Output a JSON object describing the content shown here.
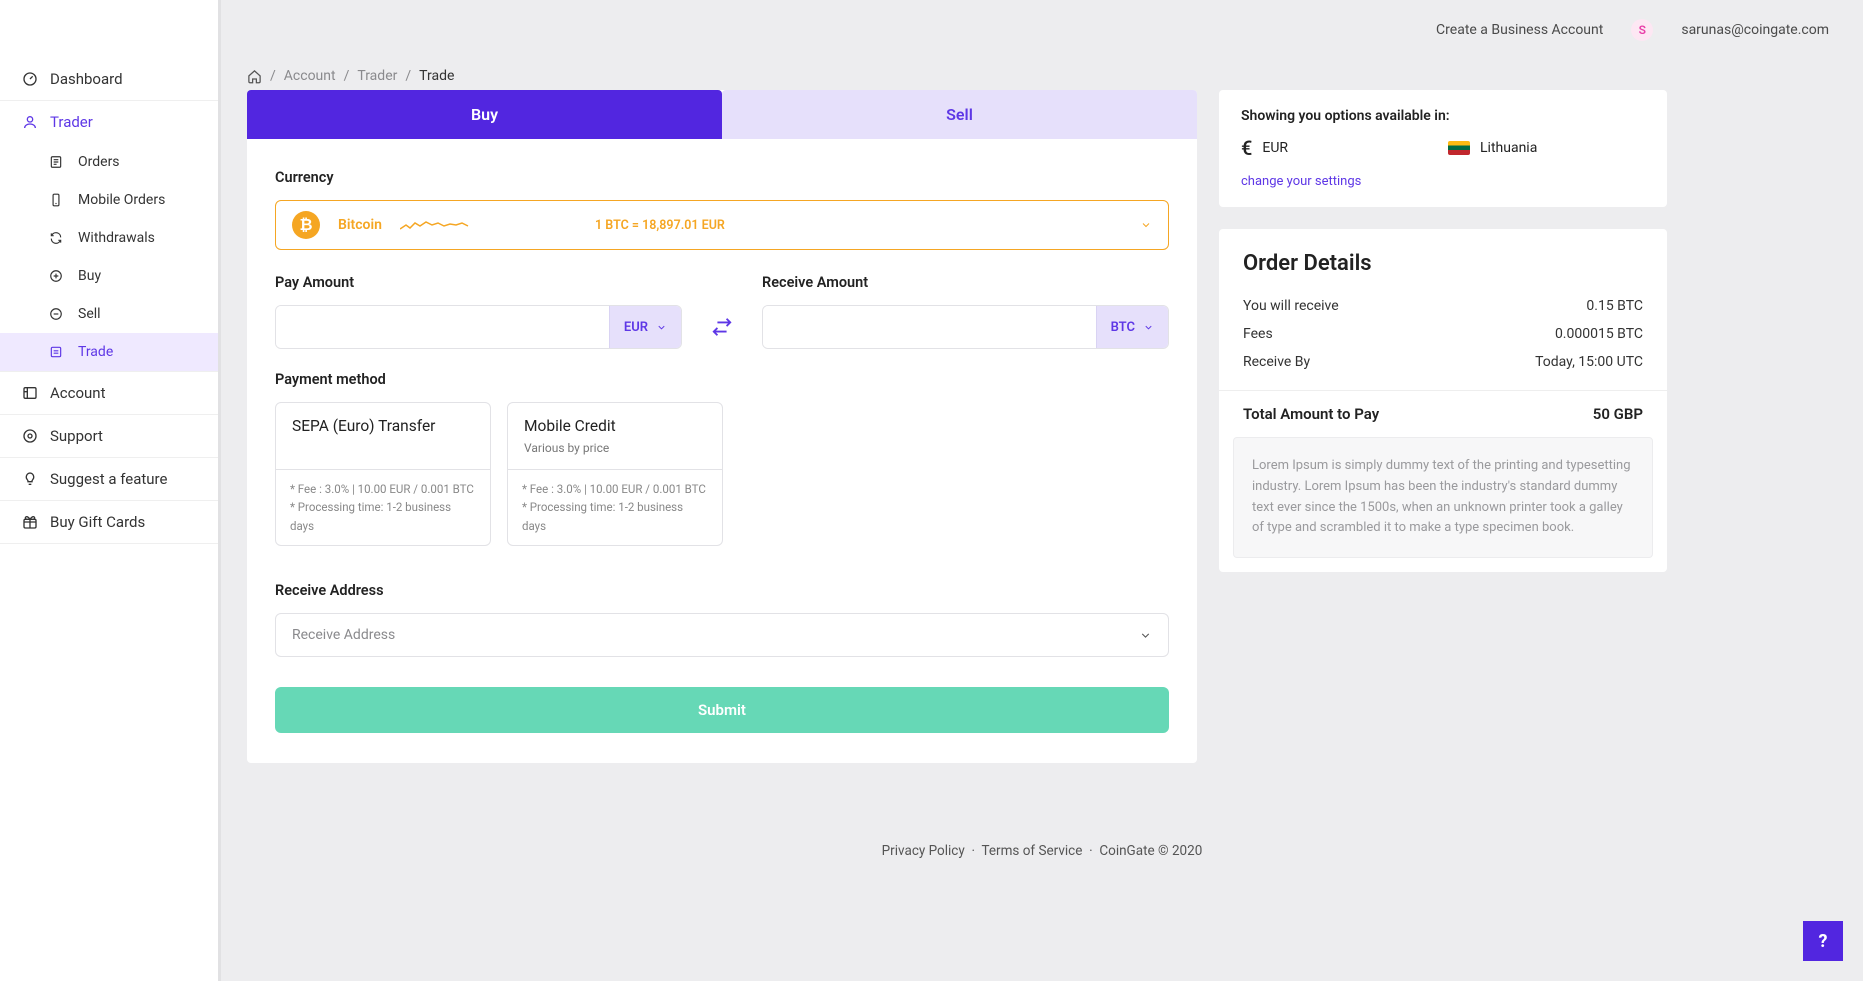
{
  "header": {
    "business_link": "Create a Business Account",
    "avatar_initial": "S",
    "user_email": "sarunas@coingate.com"
  },
  "sidebar": {
    "items": [
      {
        "label": "Dashboard"
      },
      {
        "label": "Trader"
      }
    ],
    "trader_sub": [
      {
        "label": "Orders"
      },
      {
        "label": "Mobile Orders"
      },
      {
        "label": "Withdrawals"
      },
      {
        "label": "Buy"
      },
      {
        "label": "Sell"
      },
      {
        "label": "Trade"
      }
    ],
    "bottom": [
      {
        "label": "Account"
      },
      {
        "label": "Support"
      },
      {
        "label": "Suggest a feature"
      },
      {
        "label": "Buy Gift Cards"
      }
    ]
  },
  "breadcrumb": {
    "a": "Account",
    "b": "Trader",
    "c": "Trade"
  },
  "tabs": {
    "buy": "Buy",
    "sell": "Sell"
  },
  "form": {
    "currency_label": "Currency",
    "currency_name": "Bitcoin",
    "currency_rate": "1 BTC = 18,897.01 EUR",
    "pay_label": "Pay Amount",
    "pay_unit": "EUR",
    "recv_label": "Receive Amount",
    "recv_unit": "BTC",
    "pm_label": "Payment method",
    "pm": [
      {
        "title": "SEPA (Euro) Transfer",
        "sub": "",
        "fee": "* Fee : 3.0% | 10.00 EUR / 0.001 BTC",
        "proc": "* Processing time: 1-2 business days"
      },
      {
        "title": "Mobile Credit",
        "sub": "Various by price",
        "fee": "* Fee : 3.0% | 10.00 EUR / 0.001 BTC",
        "proc": "* Processing time: 1-2 business days"
      }
    ],
    "addr_label": "Receive Address",
    "addr_placeholder": "Receive Address",
    "submit": "Submit"
  },
  "options": {
    "title": "Showing you options available in:",
    "currency": "EUR",
    "country": "Lithuania",
    "change": "change your settings"
  },
  "order": {
    "title": "Order Details",
    "rows": [
      {
        "k": "You will receive",
        "v": "0.15 BTC"
      },
      {
        "k": "Fees",
        "v": "0.000015 BTC"
      },
      {
        "k": "Receive By",
        "v": "Today, 15:00 UTC"
      }
    ],
    "total_k": "Total Amount to Pay",
    "total_v": "50 GBP",
    "note": "Lorem Ipsum is simply dummy text of the printing and typesetting industry. Lorem Ipsum has been the industry's standard dummy text ever since the 1500s, when an unknown printer took a galley of type and scrambled it to make a type specimen book."
  },
  "footer": {
    "privacy": "Privacy Policy",
    "terms": "Terms of Service",
    "copyright": "CoinGate © 2020"
  },
  "help": "?"
}
